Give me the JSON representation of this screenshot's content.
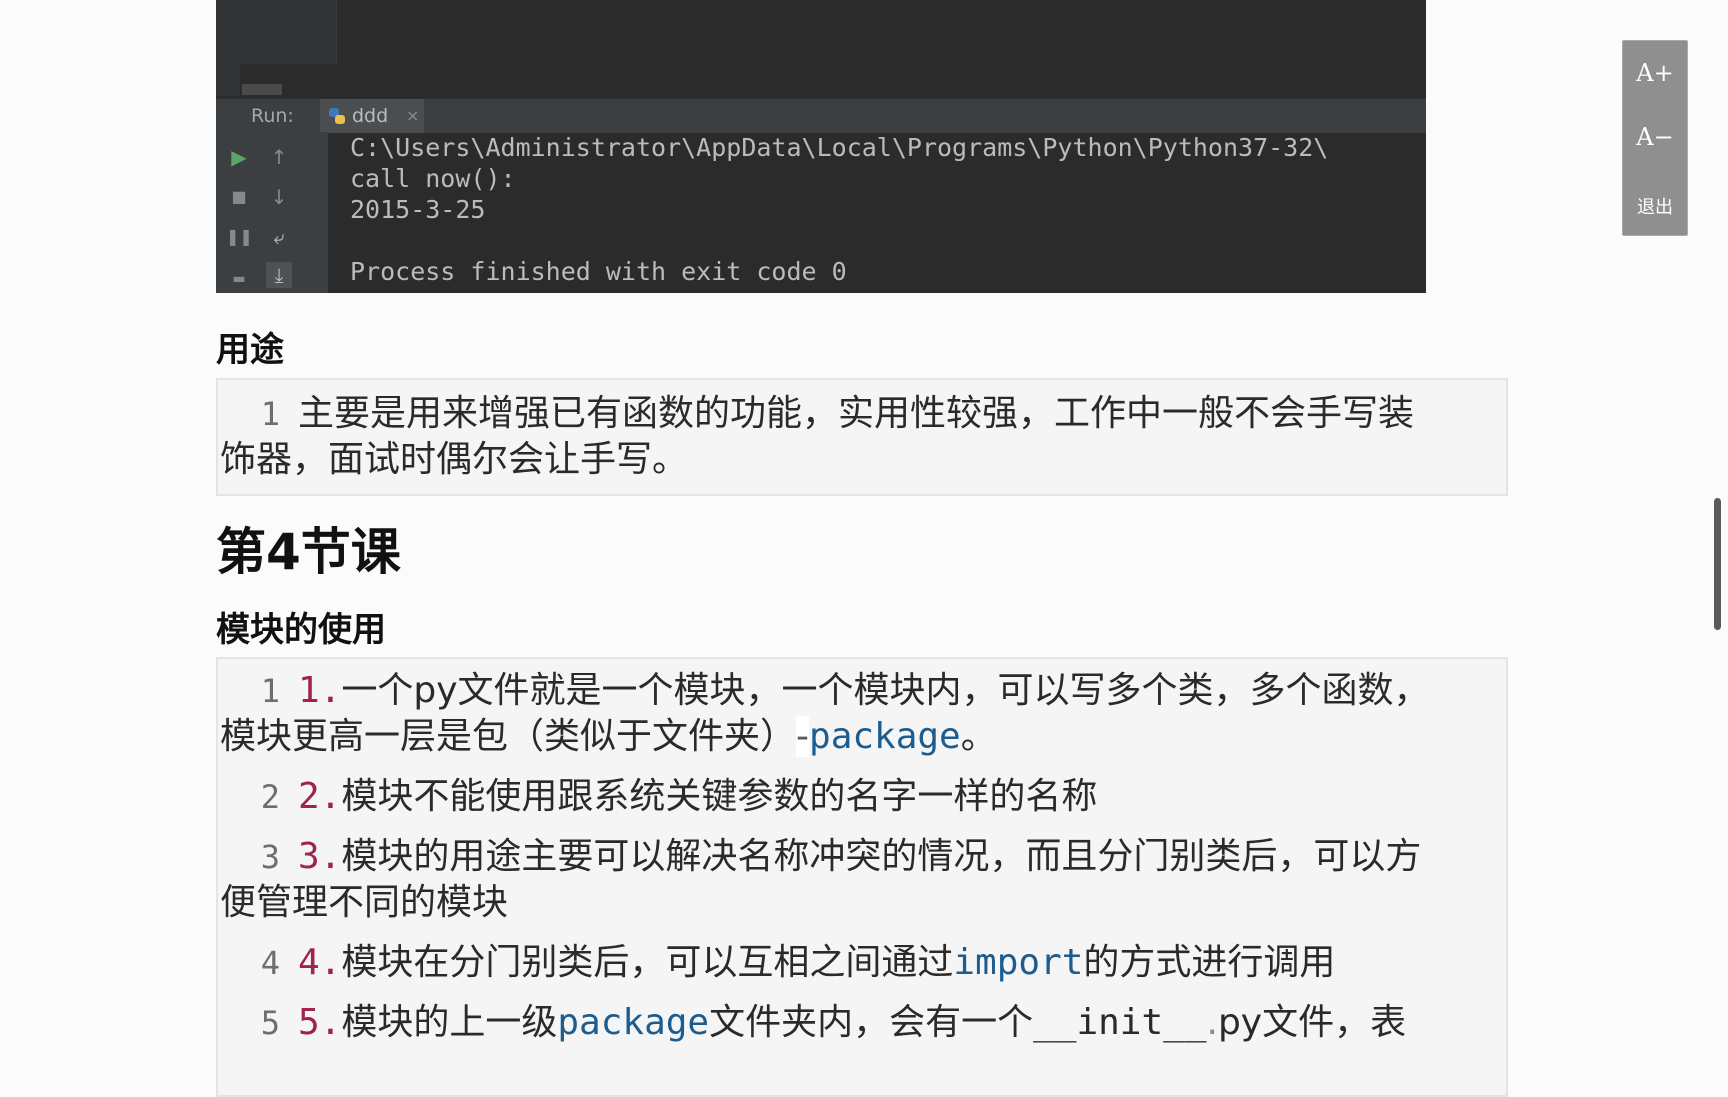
{
  "ide": {
    "run_label": "Run:",
    "tab_name": "ddd",
    "tab_close": "×",
    "console_lines": [
      "C:\\Users\\Administrator\\AppData\\Local\\Programs\\Python\\Python37-32\\",
      "call now():",
      "2015-3-25",
      "",
      "Process finished with exit code 0"
    ]
  },
  "font_panel": {
    "increase": "A+",
    "decrease": "A−",
    "exit": "退出"
  },
  "section_usage": {
    "heading": "用途",
    "lines": [
      {
        "n": "1",
        "text_a": "主要是用来增强已有函数的功能，实用性较强，工作中一般不会手写装",
        "text_b": "饰器，面试时偶尔会让手写。"
      }
    ]
  },
  "lesson": {
    "title": "第4节课"
  },
  "section_modules": {
    "heading": "模块的使用",
    "lines": [
      {
        "n": "1",
        "num": "1.",
        "text_a": "一个py文件就是一个模块，一个模块内，可以写多个类，多个函数，",
        "text_b": "模块更高一层是包（类似于文件夹）",
        "dash": "-",
        "kw": "package",
        "tail": "。"
      },
      {
        "n": "2",
        "num": "2.",
        "text_a": "模块不能使用跟系统关键参数的名字一样的名称"
      },
      {
        "n": "3",
        "num": "3.",
        "text_a": "模块的用途主要可以解决名称冲突的情况，而且分门别类后，可以方",
        "text_b": "便管理不同的模块"
      },
      {
        "n": "4",
        "num": "4.",
        "text_a": "模块在分门别类后，可以互相之间通过",
        "kw": "import",
        "tail": "的方式进行调用"
      },
      {
        "n": "5",
        "num": "5.",
        "text_a": "模块的上一级",
        "kw": "package",
        "text_c": "文件夹内，会有一个",
        "mono": "__init__",
        "dot": ".",
        "tail": "py文件，表"
      }
    ]
  }
}
